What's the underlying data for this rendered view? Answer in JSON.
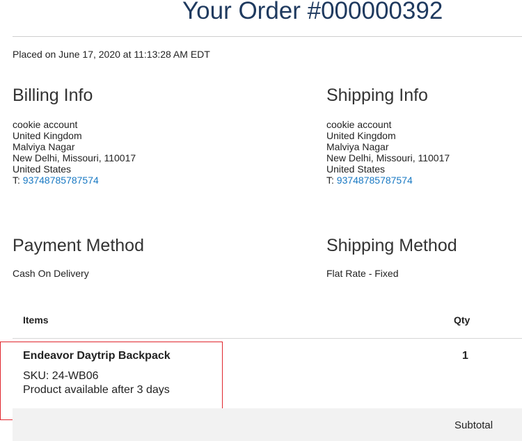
{
  "order": {
    "title": "Your Order #000000392",
    "placed": "Placed on June 17, 2020 at 11:13:28 AM EDT"
  },
  "billing": {
    "heading": "Billing Info",
    "lines": [
      "cookie account",
      "United Kingdom",
      "Malviya Nagar",
      "New Delhi, Missouri, 110017",
      "United States"
    ],
    "phone_prefix": "T: ",
    "phone": "93748785787574"
  },
  "shipping": {
    "heading": "Shipping Info",
    "lines": [
      "cookie account",
      "United Kingdom",
      "Malviya Nagar",
      "New Delhi, Missouri, 110017",
      "United States"
    ],
    "phone_prefix": "T: ",
    "phone": "93748785787574"
  },
  "payment_method": {
    "heading": "Payment Method",
    "value": "Cash On Delivery"
  },
  "shipping_method": {
    "heading": "Shipping Method",
    "value": "Flat Rate - Fixed"
  },
  "items_table": {
    "headers": [
      "Items",
      "Qty"
    ],
    "rows": [
      {
        "name": "Endeavor Daytrip Backpack",
        "sku": "SKU: 24-WB06",
        "availability": "Product available after 3 days",
        "qty": "1"
      }
    ],
    "subtotal_label": "Subtotal"
  },
  "colors": {
    "title": "#1f3a5f",
    "link": "#1979c3",
    "highlight_border": "#e0262d",
    "subtotal_band": "#f2f2f2"
  }
}
